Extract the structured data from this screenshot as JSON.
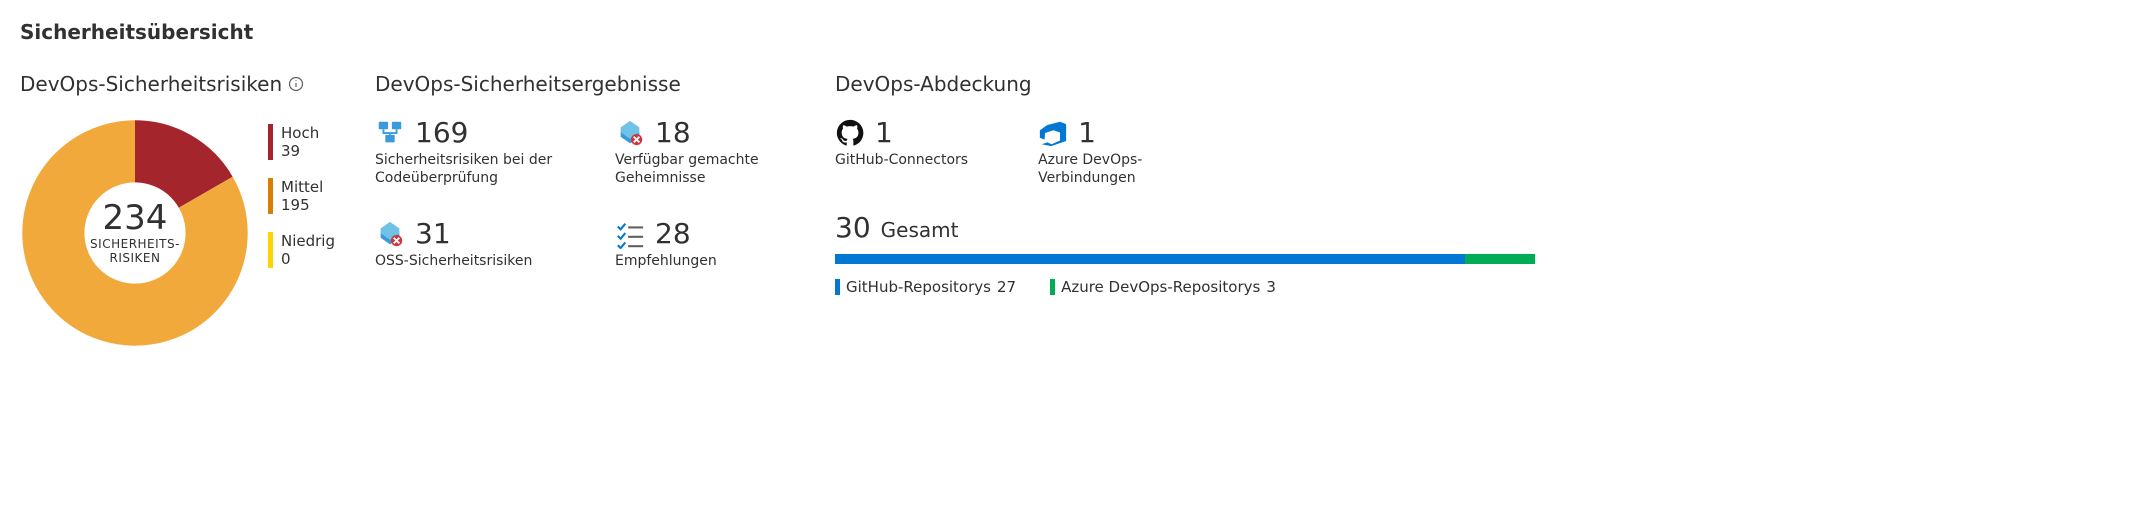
{
  "title": "Sicherheitsübersicht",
  "risks": {
    "heading": "DevOps-Sicherheitsrisiken",
    "total": "234",
    "total_label": "SICHERHEITS-\nRISIKEN",
    "legend": {
      "high": {
        "label": "Hoch",
        "value": "39",
        "color": "#a4262c"
      },
      "medium": {
        "label": "Mittel",
        "value": "195",
        "color": "#d67f00"
      },
      "low": {
        "label": "Niedrig",
        "value": "0",
        "color": "#ffd400"
      }
    }
  },
  "findings": {
    "heading": "DevOps-Sicherheitsergebnisse",
    "code": {
      "value": "169",
      "label": "Sicherheitsrisiken bei der Codeüberprüfung"
    },
    "secrets": {
      "value": "18",
      "label": "Verfügbar gemachte Geheimnisse"
    },
    "oss": {
      "value": "31",
      "label": "OSS-Sicherheitsrisiken"
    },
    "recs": {
      "value": "28",
      "label": "Empfehlungen"
    }
  },
  "coverage": {
    "heading": "DevOps-Abdeckung",
    "github": {
      "value": "1",
      "label": "GitHub-Connectors"
    },
    "ado": {
      "value": "1",
      "label": "Azure DevOps-Verbindungen"
    },
    "total": {
      "value": "30",
      "label": "Gesamt"
    },
    "bar": {
      "github_pct": "90",
      "ado_pct": "10"
    },
    "legend": {
      "github": {
        "label": "GitHub-Repositorys",
        "value": "27",
        "color": "#0078d4"
      },
      "ado": {
        "label": "Azure DevOps-Repositorys",
        "value": "3",
        "color": "#00ad56"
      }
    }
  },
  "chart_data": [
    {
      "type": "pie",
      "title": "DevOps-Sicherheitsrisiken",
      "categories": [
        "Hoch",
        "Mittel",
        "Niedrig"
      ],
      "values": [
        39,
        195,
        0
      ],
      "total": 234,
      "colors": [
        "#a4262c",
        "#f2a93b",
        "#ffd400"
      ]
    },
    {
      "type": "bar",
      "title": "DevOps-Abdeckung",
      "categories": [
        "GitHub-Repositorys",
        "Azure DevOps-Repositorys"
      ],
      "values": [
        27,
        3
      ],
      "total": 30,
      "colors": [
        "#0078d4",
        "#00ad56"
      ]
    }
  ]
}
